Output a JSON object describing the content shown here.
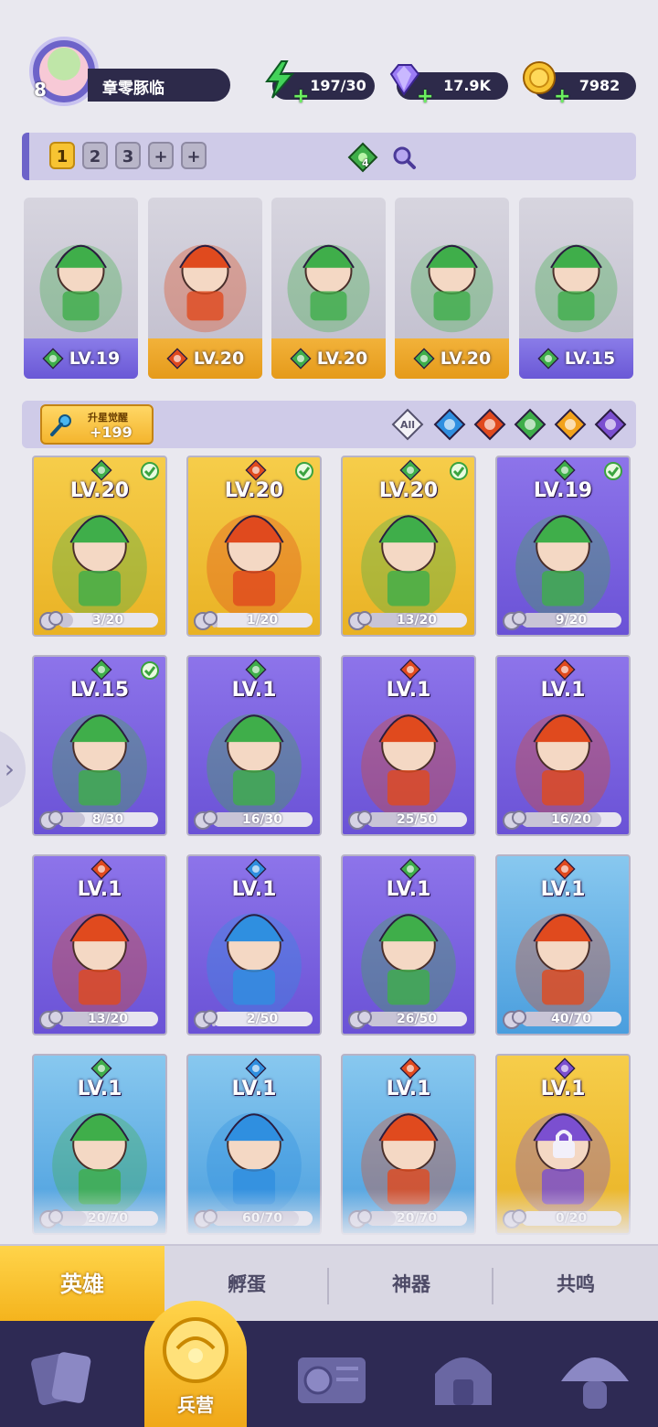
{
  "player": {
    "level": "8",
    "name": "章零豚临"
  },
  "resources": {
    "energy": {
      "icon": "lightning-icon",
      "value": "197/30"
    },
    "gems": {
      "icon": "diamond-icon",
      "value": "17.9K"
    },
    "coins": {
      "icon": "coin-icon",
      "value": "7982"
    }
  },
  "team": {
    "slots": [
      "1",
      "2",
      "3",
      "+",
      "+"
    ],
    "active_slot": "1",
    "gem_count": "4",
    "heroes": [
      {
        "level": "LV.19",
        "element": "wind",
        "band": "purple"
      },
      {
        "level": "LV.20",
        "element": "fire",
        "band": "orange"
      },
      {
        "level": "LV.20",
        "element": "wind",
        "band": "orange"
      },
      {
        "level": "LV.20",
        "element": "wind",
        "band": "orange"
      },
      {
        "level": "LV.15",
        "element": "wind",
        "band": "purple"
      }
    ]
  },
  "filter": {
    "awaken_title": "升星觉醒",
    "awaken_count": "+199",
    "all_label": "All",
    "elements": [
      "water",
      "fire",
      "wind",
      "light",
      "dark"
    ]
  },
  "roster": [
    {
      "level": "LV.20",
      "element": "wind",
      "checked": true,
      "bg": "gold",
      "progress": "3/20",
      "ratio": 0.15
    },
    {
      "level": "LV.20",
      "element": "fire",
      "checked": true,
      "bg": "gold",
      "progress": "1/20",
      "ratio": 0.05
    },
    {
      "level": "LV.20",
      "element": "wind",
      "checked": true,
      "bg": "gold",
      "progress": "13/20",
      "ratio": 0.65
    },
    {
      "level": "LV.19",
      "element": "wind",
      "checked": true,
      "bg": "purple",
      "progress": "9/20",
      "ratio": 0.45
    },
    {
      "level": "LV.15",
      "element": "wind",
      "checked": true,
      "bg": "purple",
      "progress": "8/30",
      "ratio": 0.27
    },
    {
      "level": "LV.1",
      "element": "wind",
      "checked": false,
      "bg": "purple",
      "progress": "16/30",
      "ratio": 0.53
    },
    {
      "level": "LV.1",
      "element": "fire",
      "checked": false,
      "bg": "purple",
      "progress": "25/50",
      "ratio": 0.5
    },
    {
      "level": "LV.1",
      "element": "fire",
      "checked": false,
      "bg": "purple",
      "progress": "16/20",
      "ratio": 0.8
    },
    {
      "level": "LV.1",
      "element": "fire",
      "checked": false,
      "bg": "purple",
      "progress": "13/20",
      "ratio": 0.65
    },
    {
      "level": "LV.1",
      "element": "water",
      "checked": false,
      "bg": "purple",
      "progress": "2/50",
      "ratio": 0.04
    },
    {
      "level": "LV.1",
      "element": "wind",
      "checked": false,
      "bg": "purple",
      "progress": "26/50",
      "ratio": 0.52
    },
    {
      "level": "LV.1",
      "element": "fire",
      "checked": false,
      "bg": "blue",
      "progress": "40/70",
      "ratio": 0.57
    },
    {
      "level": "LV.1",
      "element": "wind",
      "checked": false,
      "bg": "blue",
      "progress": "20/70",
      "ratio": 0.29
    },
    {
      "level": "LV.1",
      "element": "water",
      "checked": false,
      "bg": "blue",
      "progress": "60/70",
      "ratio": 0.86
    },
    {
      "level": "LV.1",
      "element": "fire",
      "checked": false,
      "bg": "blue",
      "progress": "20/70",
      "ratio": 0.29
    },
    {
      "level": "LV.1",
      "element": "dark",
      "checked": false,
      "bg": "gold",
      "progress": "0/20",
      "ratio": 0,
      "locked": true
    }
  ],
  "subtabs": [
    "英雄",
    "孵蛋",
    "神器",
    "共鸣"
  ],
  "active_subtab": "英雄",
  "nav": {
    "active_label": "兵营",
    "items": [
      "cards-icon",
      "barracks-icon",
      "map-book-icon",
      "shrine-icon",
      "mushroom-icon"
    ]
  },
  "colors": {
    "wind": "#3fae4a",
    "fire": "#e04a1e",
    "water": "#2f8fe0",
    "light": "#f2a21a",
    "dark": "#7b4fd0",
    "accent": "#f4b52e",
    "nav_bg": "#2e2a54"
  }
}
